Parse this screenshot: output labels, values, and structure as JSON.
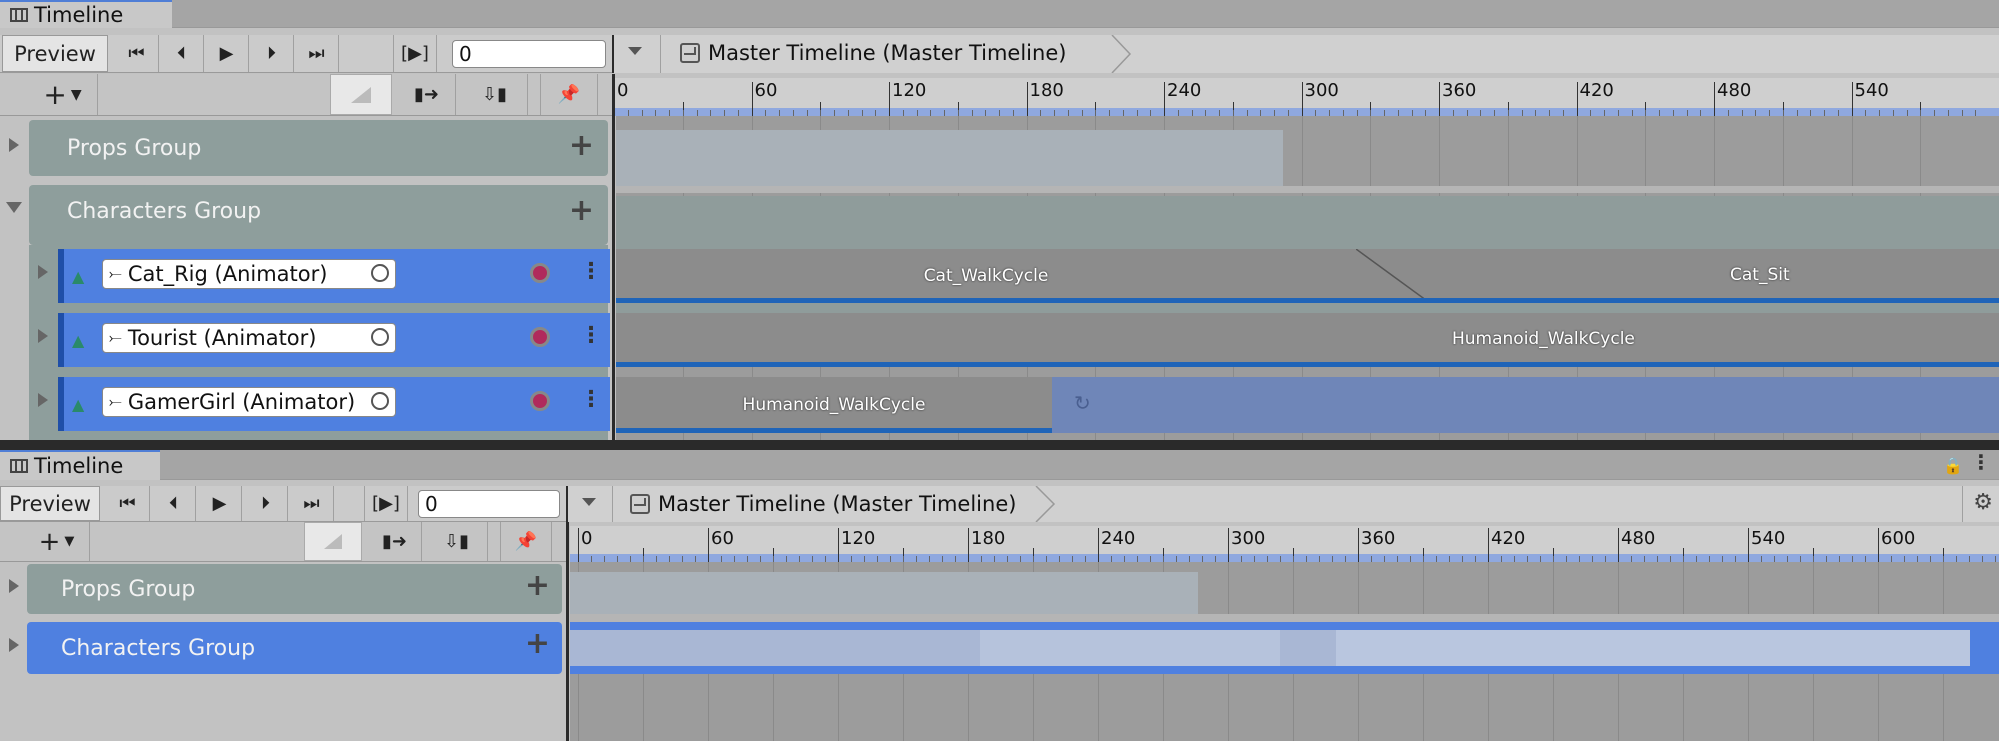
{
  "top": {
    "tab_title": "Timeline",
    "preview_label": "Preview",
    "play_range_label": "[▶]",
    "frame_value": "0",
    "crumb_label": "Master Timeline (Master Timeline)",
    "ruler_labels": [
      "0",
      "60",
      "120",
      "180",
      "240",
      "300",
      "360",
      "420",
      "480",
      "540"
    ],
    "groups": [
      {
        "name": "Props Group"
      },
      {
        "name": "Characters Group"
      }
    ],
    "tracks": [
      {
        "object": "Cat_Rig (Animator)"
      },
      {
        "object": "Tourist (Animator)"
      },
      {
        "object": "GamerGirl (Animator)"
      }
    ],
    "clips": {
      "cat_walk": "Cat_WalkCycle",
      "cat_sit": "Cat_Sit",
      "tourist_walk": "Humanoid_WalkCycle",
      "gamer_walk": "Humanoid_WalkCycle"
    }
  },
  "bottom": {
    "tab_title": "Timeline",
    "preview_label": "Preview",
    "play_range_label": "[▶]",
    "frame_value": "0",
    "crumb_label": "Master Timeline (Master Timeline)",
    "ruler_labels": [
      "0",
      "60",
      "120",
      "180",
      "240",
      "300",
      "360",
      "420",
      "480",
      "540",
      "600"
    ],
    "groups": [
      {
        "name": "Props Group"
      },
      {
        "name": "Characters Group"
      }
    ]
  },
  "colors": {
    "accent": "#4f80e0",
    "clip_bar": "#1f64b8",
    "record": "#b02a5c"
  }
}
